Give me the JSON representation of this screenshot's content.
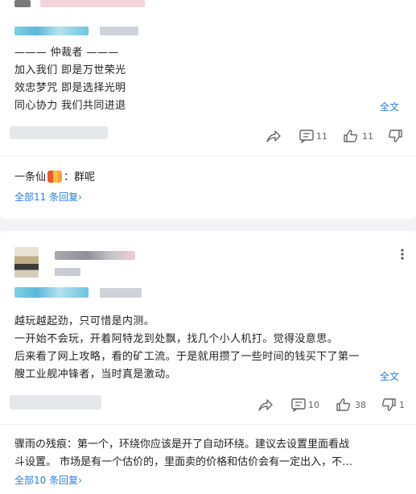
{
  "comment1": {
    "lines": [
      "——— 仲裁者 ———",
      "加入我们 即是万世荣光",
      "效忠梦咒 即是选择光明",
      "同心协力 我们共同进退"
    ],
    "expand_label": "全文",
    "comment_count": "11",
    "like_count": "11",
    "reply": {
      "author": "一条仙",
      "separator": "：",
      "text": "群呢"
    },
    "all_replies_label": "全部11 条回复",
    "all_replies_arrow": "›"
  },
  "comment2": {
    "more_icon": "more-vertical-icon",
    "lines": [
      "越玩越起劲，只可惜是内测。",
      "一开始不会玩，开着阿特龙到处飘，找几个小人机打。觉得没意思。",
      "后来看了网上攻略，看的矿工流。于是就用攒了一些时间的钱买下了第一",
      "艘工业舰冲锋者，当时真是激动。"
    ],
    "expand_label": "全文",
    "comment_count": "10",
    "like_count": "38",
    "dislike_count": "1",
    "reply": {
      "line1": "骤雨の残痕：第一个，环绕你应该是开了自动环绕。建议去设置里面看战",
      "line2": "斗设置。 市场是有一个估价的，里面卖的价格和估价会有一定出入，不…"
    },
    "all_replies_label": "全部10 条回复",
    "all_replies_arrow": "›"
  },
  "colors": {
    "link": "#2b7de0",
    "background": "#f3f3f6",
    "card": "#ffffff"
  }
}
